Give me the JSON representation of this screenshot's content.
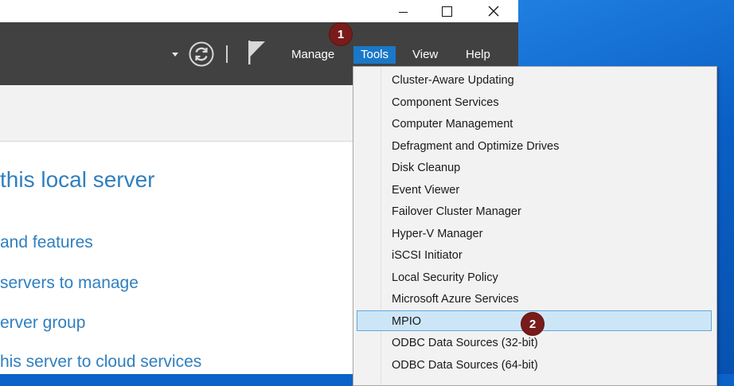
{
  "toolbar": {
    "menus": {
      "manage": "Manage",
      "tools": "Tools",
      "view": "View",
      "help": "Help"
    }
  },
  "annotations": {
    "step1": "1",
    "step2": "2"
  },
  "content": {
    "title_fragment": "this local server",
    "links": [
      "and features",
      " servers to manage",
      "erver group",
      "his server to cloud services"
    ]
  },
  "tools_menu": {
    "items": [
      "Cluster-Aware Updating",
      "Component Services",
      "Computer Management",
      "Defragment and Optimize Drives",
      "Disk Cleanup",
      "Event Viewer",
      "Failover Cluster Manager",
      "Hyper-V Manager",
      "iSCSI Initiator",
      "Local Security Policy",
      "Microsoft Azure Services",
      "MPIO",
      "ODBC Data Sources (32-bit)",
      "ODBC Data Sources (64-bit)"
    ],
    "selected_item": "MPIO"
  },
  "colors": {
    "toolbar_bg": "#414141",
    "tools_highlight": "#1a78c8",
    "link_text": "#2f7fbf",
    "badge": "#7a1b1b",
    "menu_selected": "#cde6f7"
  },
  "icons": {
    "refresh": "refresh-icon",
    "flag": "notifications-flag-icon",
    "dropdown": "chevron-down-icon"
  }
}
